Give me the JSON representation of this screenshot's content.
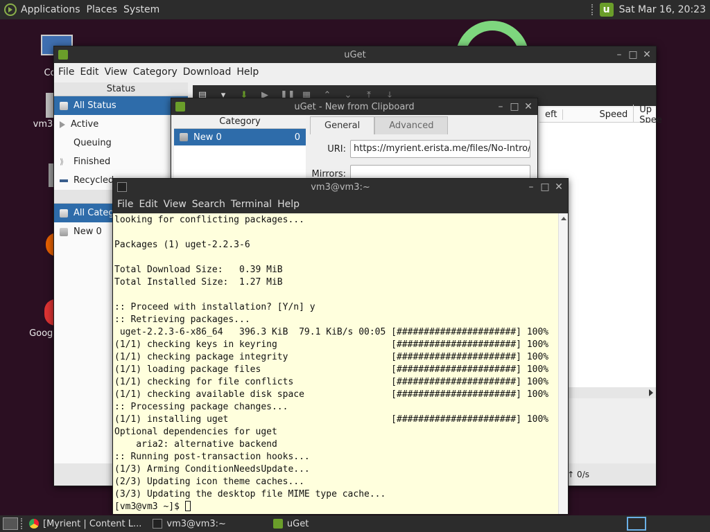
{
  "top_panel": {
    "menus": [
      "Applications",
      "Places",
      "System"
    ],
    "clock": "Sat Mar 16, 20:23"
  },
  "desktop": {
    "icons": [
      {
        "label": "Co",
        "name": "computer"
      },
      {
        "label": "vm3",
        "name": "home-folder"
      },
      {
        "label": "T",
        "name": "trash"
      },
      {
        "label": "F",
        "name": "firefox"
      },
      {
        "label": "Googl",
        "name": "google-chrome"
      }
    ]
  },
  "uget_main": {
    "title": "uGet",
    "menu": [
      "File",
      "Edit",
      "View",
      "Category",
      "Download",
      "Help"
    ],
    "status_header": "Status",
    "status_items": [
      {
        "label": "All Status",
        "selected": true
      },
      {
        "label": "Active",
        "selected": false
      },
      {
        "label": "Queuing",
        "selected": false
      },
      {
        "label": "Finished",
        "selected": false
      },
      {
        "label": "Recycled",
        "selected": false
      }
    ],
    "category_header": "Ca",
    "category_items": [
      {
        "label": "All Catego",
        "selected": true
      },
      {
        "label": "New 0",
        "selected": false
      }
    ],
    "columns": [
      "eft",
      "Speed",
      "Up Spee"
    ],
    "status_bar": "↑ 0/s"
  },
  "clipboard_dialog": {
    "title": "uGet - New from Clipboard",
    "category_header": "Category",
    "category_item": {
      "label": "New 0",
      "count": "0"
    },
    "tabs": [
      {
        "label": "General",
        "active": true
      },
      {
        "label": "Advanced",
        "active": false
      }
    ],
    "uri_label": "URI:",
    "uri_value": "https://myrient.erista.me/files/No-Intro/N",
    "mirrors_label": "Mirrors:"
  },
  "terminal": {
    "title": "vm3@vm3:~",
    "menu": [
      "File",
      "Edit",
      "View",
      "Search",
      "Terminal",
      "Help"
    ],
    "lines": [
      "looking for conflicting packages...",
      "",
      "Packages (1) uget-2.2.3-6",
      "",
      "Total Download Size:   0.39 MiB",
      "Total Installed Size:  1.27 MiB",
      "",
      ":: Proceed with installation? [Y/n] y",
      ":: Retrieving packages...",
      " uget-2.2.3-6-x86_64   396.3 KiB  79.1 KiB/s 00:05 [######################] 100%",
      "(1/1) checking keys in keyring                     [######################] 100%",
      "(1/1) checking package integrity                   [######################] 100%",
      "(1/1) loading package files                        [######################] 100%",
      "(1/1) checking for file conflicts                  [######################] 100%",
      "(1/1) checking available disk space                [######################] 100%",
      ":: Processing package changes...",
      "(1/1) installing uget                              [######################] 100%",
      "Optional dependencies for uget",
      "    aria2: alternative backend",
      ":: Running post-transaction hooks...",
      "(1/3) Arming ConditionNeedsUpdate...",
      "(2/3) Updating icon theme caches...",
      "(3/3) Updating the desktop file MIME type cache..."
    ],
    "prompt": "[vm3@vm3 ~]$ "
  },
  "taskbar": {
    "tasks": [
      {
        "label": "[Myrient | Content L...",
        "icon": "chrome-icon"
      },
      {
        "label": "vm3@vm3:~",
        "icon": "terminal-icon"
      },
      {
        "label": "uGet",
        "icon": "uget-icon"
      }
    ]
  }
}
